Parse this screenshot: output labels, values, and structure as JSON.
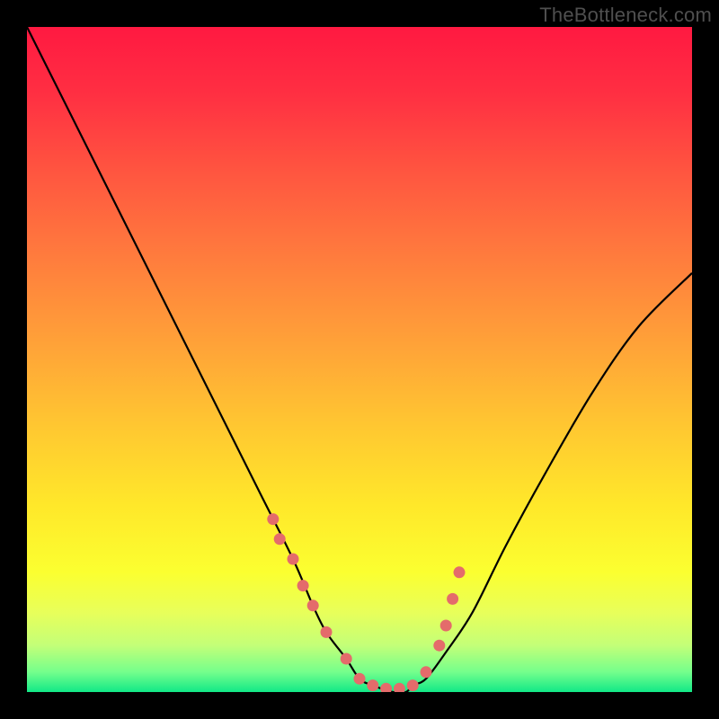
{
  "watermark": "TheBottleneck.com",
  "chart_data": {
    "type": "line",
    "title": "",
    "xlabel": "",
    "ylabel": "",
    "xlim": [
      0,
      100
    ],
    "ylim": [
      0,
      100
    ],
    "series": [
      {
        "name": "curve",
        "x": [
          0,
          5,
          10,
          15,
          20,
          25,
          30,
          35,
          40,
          43,
          45,
          48,
          50,
          52,
          55,
          57,
          58,
          60,
          63,
          67,
          72,
          78,
          85,
          92,
          100
        ],
        "y": [
          100,
          90,
          80,
          70,
          60,
          50,
          40,
          30,
          20,
          13,
          9,
          5,
          2,
          1,
          0,
          0,
          1,
          2,
          6,
          12,
          22,
          33,
          45,
          55,
          63
        ]
      }
    ],
    "markers": {
      "name": "dots",
      "x": [
        37,
        38,
        40,
        41.5,
        43,
        45,
        48,
        50,
        52,
        54,
        56,
        58,
        60,
        62,
        63,
        64,
        65
      ],
      "y": [
        26,
        23,
        20,
        16,
        13,
        9,
        5,
        2,
        1,
        0.5,
        0.5,
        1,
        3,
        7,
        10,
        14,
        18
      ]
    },
    "gradient_stops": [
      {
        "offset": 0.0,
        "color": "#ff1941"
      },
      {
        "offset": 0.1,
        "color": "#ff2f42"
      },
      {
        "offset": 0.22,
        "color": "#ff5640"
      },
      {
        "offset": 0.35,
        "color": "#ff7d3d"
      },
      {
        "offset": 0.48,
        "color": "#ffa338"
      },
      {
        "offset": 0.6,
        "color": "#ffc731"
      },
      {
        "offset": 0.72,
        "color": "#ffe82a"
      },
      {
        "offset": 0.82,
        "color": "#fbff30"
      },
      {
        "offset": 0.88,
        "color": "#e8ff5a"
      },
      {
        "offset": 0.93,
        "color": "#c3ff78"
      },
      {
        "offset": 0.97,
        "color": "#74ff8c"
      },
      {
        "offset": 1.0,
        "color": "#12e887"
      }
    ],
    "marker_color": "#e46b6b",
    "curve_color": "#000000"
  }
}
